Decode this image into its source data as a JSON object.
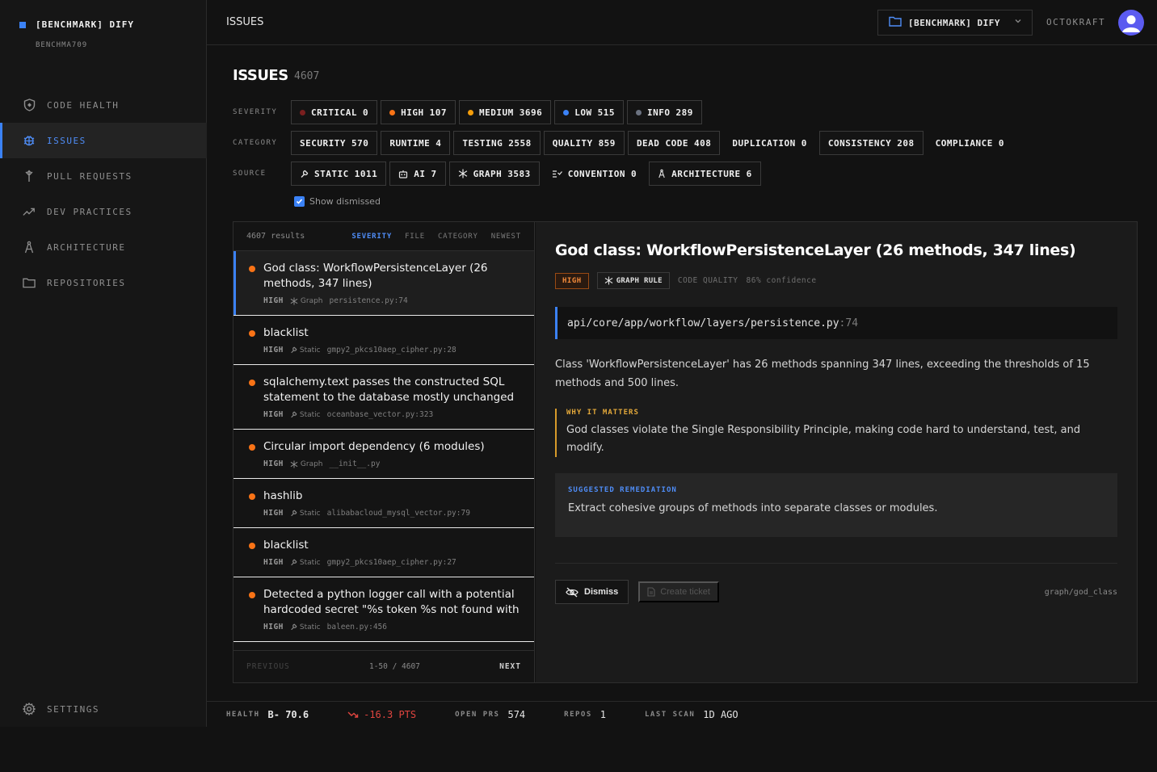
{
  "brand": {
    "title": "[BENCHMARK] DIFY",
    "subtitle": "BENCHMA709"
  },
  "nav": [
    {
      "label": "CODE HEALTH",
      "icon": "shield-icon"
    },
    {
      "label": "ISSUES",
      "icon": "bug-icon",
      "active": true
    },
    {
      "label": "PULL REQUESTS",
      "icon": "merge-icon"
    },
    {
      "label": "DEV PRACTICES",
      "icon": "trending-icon"
    },
    {
      "label": "ARCHITECTURE",
      "icon": "compass-icon"
    },
    {
      "label": "REPOSITORIES",
      "icon": "folder-icon"
    }
  ],
  "settings": {
    "label": "SETTINGS",
    "icon": "gear-icon"
  },
  "topbar": {
    "title": "ISSUES",
    "repo": "[BENCHMARK] DIFY",
    "org": "OCTOKRAFT"
  },
  "page": {
    "title": "ISSUES",
    "count": "4607"
  },
  "filters": {
    "severity_label": "SEVERITY",
    "severity": [
      {
        "label": "CRITICAL",
        "count": "0",
        "color": "#7a1f1f"
      },
      {
        "label": "HIGH",
        "count": "107",
        "color": "#f97316"
      },
      {
        "label": "MEDIUM",
        "count": "3696",
        "color": "#f59e0b"
      },
      {
        "label": "LOW",
        "count": "515",
        "color": "#3b82f6"
      },
      {
        "label": "INFO",
        "count": "289",
        "color": "#6b7280"
      }
    ],
    "category_label": "CATEGORY",
    "category": [
      {
        "label": "SECURITY",
        "count": "570"
      },
      {
        "label": "RUNTIME",
        "count": "4"
      },
      {
        "label": "TESTING",
        "count": "2558"
      },
      {
        "label": "QUALITY",
        "count": "859"
      },
      {
        "label": "DEAD CODE",
        "count": "408"
      },
      {
        "label": "DUPLICATION",
        "count": "0"
      },
      {
        "label": "CONSISTENCY",
        "count": "208"
      },
      {
        "label": "COMPLIANCE",
        "count": "0"
      }
    ],
    "source_label": "SOURCE",
    "source": [
      {
        "label": "STATIC",
        "count": "1011",
        "icon": "wrench-icon"
      },
      {
        "label": "AI",
        "count": "7",
        "icon": "robot-icon"
      },
      {
        "label": "GRAPH",
        "count": "3583",
        "icon": "graph-icon"
      },
      {
        "label": "CONVENTION",
        "count": "0",
        "icon": "list-check-icon"
      },
      {
        "label": "ARCHITECTURE",
        "count": "6",
        "icon": "compass-icon"
      }
    ],
    "show_dismissed": "Show dismissed"
  },
  "list": {
    "results": "4607 results",
    "sorts": [
      "SEVERITY",
      "FILE",
      "CATEGORY",
      "NEWEST"
    ],
    "items": [
      {
        "title": "God class: WorkflowPersistenceLayer (26 methods, 347 lines)",
        "sev": "HIGH",
        "source": "Graph",
        "file": "persistence.py:74"
      },
      {
        "title": "blacklist",
        "sev": "HIGH",
        "source": "Static",
        "file": "gmpy2_pkcs10aep_cipher.py:28"
      },
      {
        "title": "sqlalchemy.text passes the constructed SQL statement to the database mostly unchanged",
        "sev": "HIGH",
        "source": "Static",
        "file": "oceanbase_vector.py:323"
      },
      {
        "title": "Circular import dependency (6 modules)",
        "sev": "HIGH",
        "source": "Graph",
        "file": "__init__.py"
      },
      {
        "title": "hashlib",
        "sev": "HIGH",
        "source": "Static",
        "file": "alibabacloud_mysql_vector.py:79"
      },
      {
        "title": "blacklist",
        "sev": "HIGH",
        "source": "Static",
        "file": "gmpy2_pkcs10aep_cipher.py:27"
      },
      {
        "title": "Detected a python logger call with a potential hardcoded secret \"%s token %s not found with",
        "sev": "HIGH",
        "source": "Static",
        "file": "baleen.py:456"
      }
    ],
    "prev": "PREVIOUS",
    "pager": "1-50 / 4607",
    "next": "NEXT"
  },
  "detail": {
    "title": "God class: WorkflowPersistenceLayer (26 methods, 347 lines)",
    "severity": "HIGH",
    "rule_type": "GRAPH RULE",
    "category": "CODE QUALITY",
    "confidence": "86% confidence",
    "path": "api/core/app/workflow/layers/persistence.py",
    "line": ":74",
    "description": "Class 'WorkflowPersistenceLayer' has 26 methods spanning 347 lines, exceeding the thresholds of 15 methods and 500 lines.",
    "why_heading": "WHY IT MATTERS",
    "why_text": "God classes violate the Single Responsibility Principle, making code hard to understand, test, and modify.",
    "remediation_heading": "SUGGESTED REMEDIATION",
    "remediation_text": "Extract cohesive groups of methods into separate classes or modules.",
    "dismiss": "Dismiss",
    "create_ticket": "Create ticket",
    "rule_id": "graph/god_class"
  },
  "status": {
    "health_label": "HEALTH",
    "health_value": "B- 70.6",
    "delta": "-16.3 PTS",
    "prs_label": "OPEN PRS",
    "prs_value": "574",
    "repos_label": "REPOS",
    "repos_value": "1",
    "scan_label": "LAST SCAN",
    "scan_value": "1D AGO"
  }
}
